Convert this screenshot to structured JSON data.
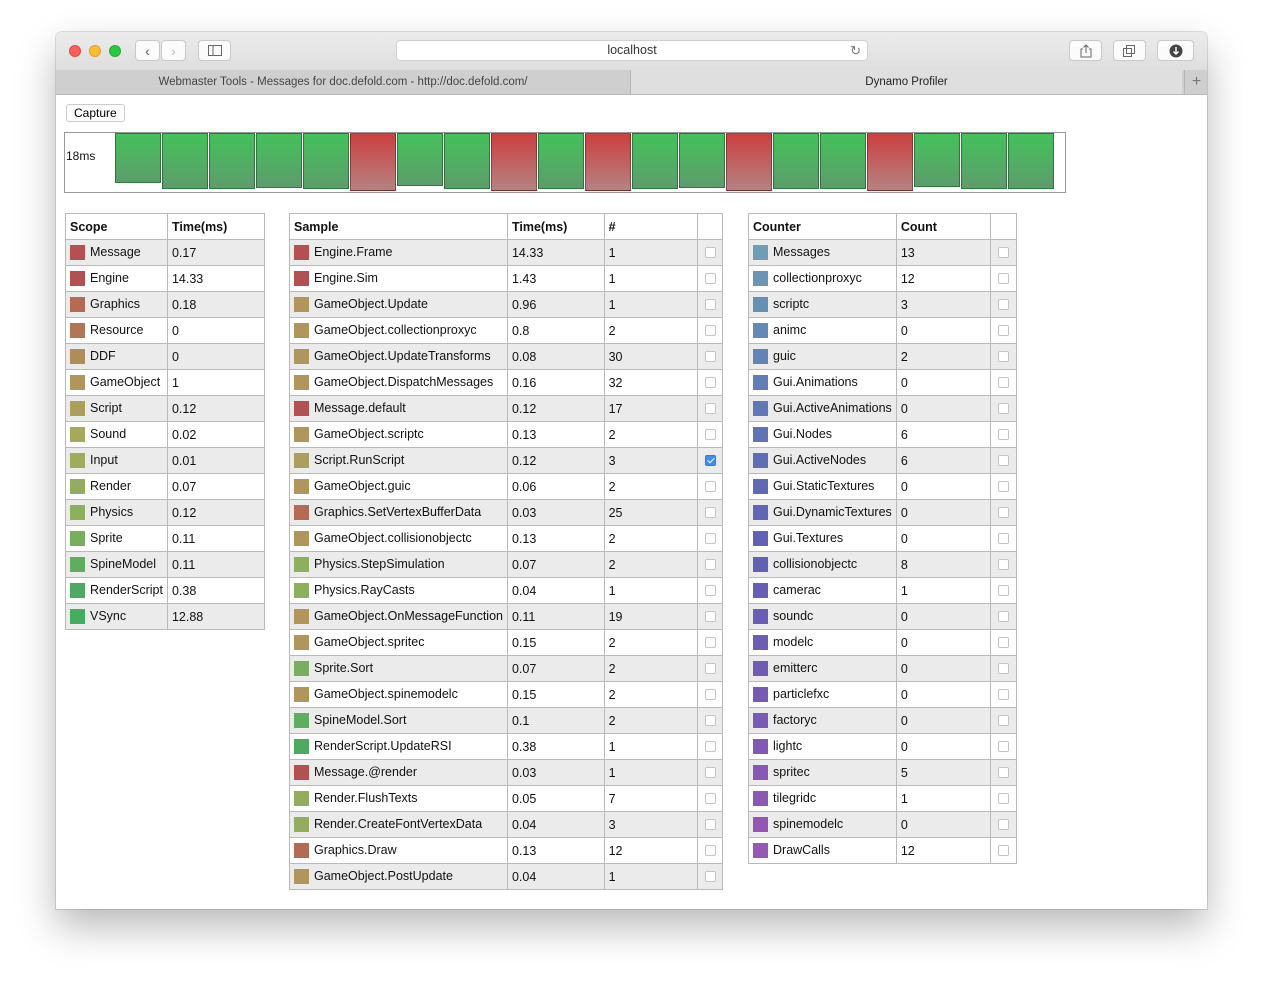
{
  "browser": {
    "address": "localhost",
    "tabs": [
      "Webmaster Tools - Messages for doc.defold.com - http://doc.defold.com/",
      "Dynamo Profiler"
    ],
    "plus": "+"
  },
  "profiler": {
    "capture_label": "Capture",
    "frame_label": "18ms",
    "frames": [
      {
        "status": "green",
        "fill": 0.89
      },
      {
        "status": "green",
        "fill": 1.0
      },
      {
        "status": "green",
        "fill": 1.0
      },
      {
        "status": "green",
        "fill": 0.98
      },
      {
        "status": "green",
        "fill": 1.0
      },
      {
        "status": "red",
        "fill": 1.04
      },
      {
        "status": "green",
        "fill": 0.95
      },
      {
        "status": "green",
        "fill": 1.0
      },
      {
        "status": "red",
        "fill": 1.04
      },
      {
        "status": "green",
        "fill": 1.0
      },
      {
        "status": "red",
        "fill": 1.04
      },
      {
        "status": "green",
        "fill": 1.0
      },
      {
        "status": "green",
        "fill": 0.98
      },
      {
        "status": "red",
        "fill": 1.04
      },
      {
        "status": "green",
        "fill": 1.0
      },
      {
        "status": "green",
        "fill": 1.0
      },
      {
        "status": "red",
        "fill": 1.04
      },
      {
        "status": "green",
        "fill": 0.97
      },
      {
        "status": "green",
        "fill": 1.0
      },
      {
        "status": "green",
        "fill": 1.0
      }
    ]
  },
  "scope_table": {
    "headers": [
      "Scope",
      "Time(ms)"
    ],
    "rows": [
      {
        "name": "Message",
        "time": "0.17",
        "color": "#b45052"
      },
      {
        "name": "Engine",
        "time": "14.33",
        "color": "#b45052"
      },
      {
        "name": "Graphics",
        "time": "0.18",
        "color": "#b36b53"
      },
      {
        "name": "Resource",
        "time": "0",
        "color": "#b07757"
      },
      {
        "name": "DDF",
        "time": "0",
        "color": "#b08c5b"
      },
      {
        "name": "GameObject",
        "time": "1",
        "color": "#b0965c"
      },
      {
        "name": "Script",
        "time": "0.12",
        "color": "#ac9f5c"
      },
      {
        "name": "Sound",
        "time": "0.02",
        "color": "#a6a85c"
      },
      {
        "name": "Input",
        "time": "0.01",
        "color": "#9fac5c"
      },
      {
        "name": "Render",
        "time": "0.07",
        "color": "#91ad5d"
      },
      {
        "name": "Physics",
        "time": "0.12",
        "color": "#8cb05e"
      },
      {
        "name": "Sprite",
        "time": "0.11",
        "color": "#7aae5f"
      },
      {
        "name": "SpineModel",
        "time": "0.11",
        "color": "#5fad60"
      },
      {
        "name": "RenderScript",
        "time": "0.38",
        "color": "#4daa60"
      },
      {
        "name": "VSync",
        "time": "12.88",
        "color": "#45ad5d"
      }
    ]
  },
  "sample_table": {
    "headers": [
      "Sample",
      "Time(ms)",
      "#",
      ""
    ],
    "rows": [
      {
        "name": "Engine.Frame",
        "time": "14.33",
        "count": "1",
        "checked": false,
        "color": "#b45052"
      },
      {
        "name": "Engine.Sim",
        "time": "1.43",
        "count": "1",
        "checked": false,
        "color": "#b45052"
      },
      {
        "name": "GameObject.Update",
        "time": "0.96",
        "count": "1",
        "checked": false,
        "color": "#b0965c"
      },
      {
        "name": "GameObject.collectionproxyc",
        "time": "0.8",
        "count": "2",
        "checked": false,
        "color": "#b0965c"
      },
      {
        "name": "GameObject.UpdateTransforms",
        "time": "0.08",
        "count": "30",
        "checked": false,
        "color": "#b0965c"
      },
      {
        "name": "GameObject.DispatchMessages",
        "time": "0.16",
        "count": "32",
        "checked": false,
        "color": "#b0965c"
      },
      {
        "name": "Message.default",
        "time": "0.12",
        "count": "17",
        "checked": false,
        "color": "#b45052"
      },
      {
        "name": "GameObject.scriptc",
        "time": "0.13",
        "count": "2",
        "checked": false,
        "color": "#b0965c"
      },
      {
        "name": "Script.RunScript",
        "time": "0.12",
        "count": "3",
        "checked": true,
        "color": "#ac9f5c"
      },
      {
        "name": "GameObject.guic",
        "time": "0.06",
        "count": "2",
        "checked": false,
        "color": "#b0965c"
      },
      {
        "name": "Graphics.SetVertexBufferData",
        "time": "0.03",
        "count": "25",
        "checked": false,
        "color": "#b36b53"
      },
      {
        "name": "GameObject.collisionobjectc",
        "time": "0.13",
        "count": "2",
        "checked": false,
        "color": "#b0965c"
      },
      {
        "name": "Physics.StepSimulation",
        "time": "0.07",
        "count": "2",
        "checked": false,
        "color": "#8cb05e"
      },
      {
        "name": "Physics.RayCasts",
        "time": "0.04",
        "count": "1",
        "checked": false,
        "color": "#8cb05e"
      },
      {
        "name": "GameObject.OnMessageFunction",
        "time": "0.11",
        "count": "19",
        "checked": false,
        "color": "#b0965c"
      },
      {
        "name": "GameObject.spritec",
        "time": "0.15",
        "count": "2",
        "checked": false,
        "color": "#b0965c"
      },
      {
        "name": "Sprite.Sort",
        "time": "0.07",
        "count": "2",
        "checked": false,
        "color": "#7aae5f"
      },
      {
        "name": "GameObject.spinemodelc",
        "time": "0.15",
        "count": "2",
        "checked": false,
        "color": "#b0965c"
      },
      {
        "name": "SpineModel.Sort",
        "time": "0.1",
        "count": "2",
        "checked": false,
        "color": "#5fad60"
      },
      {
        "name": "RenderScript.UpdateRSI",
        "time": "0.38",
        "count": "1",
        "checked": false,
        "color": "#4daa60"
      },
      {
        "name": "Message.@render",
        "time": "0.03",
        "count": "1",
        "checked": false,
        "color": "#b45052"
      },
      {
        "name": "Render.FlushTexts",
        "time": "0.05",
        "count": "7",
        "checked": false,
        "color": "#91ad5d"
      },
      {
        "name": "Render.CreateFontVertexData",
        "time": "0.04",
        "count": "3",
        "checked": false,
        "color": "#91ad5d"
      },
      {
        "name": "Graphics.Draw",
        "time": "0.13",
        "count": "12",
        "checked": false,
        "color": "#b36b53"
      },
      {
        "name": "GameObject.PostUpdate",
        "time": "0.04",
        "count": "1",
        "checked": false,
        "color": "#b0965c"
      }
    ]
  },
  "counter_table": {
    "headers": [
      "Counter",
      "Count",
      ""
    ],
    "rows": [
      {
        "name": "Messages",
        "count": "13",
        "checked": false,
        "color": "#6f9db5"
      },
      {
        "name": "collectionproxyc",
        "count": "12",
        "checked": false,
        "color": "#6996b5"
      },
      {
        "name": "scriptc",
        "count": "3",
        "checked": false,
        "color": "#6590b6"
      },
      {
        "name": "animc",
        "count": "0",
        "checked": false,
        "color": "#6389b6"
      },
      {
        "name": "guic",
        "count": "2",
        "checked": false,
        "color": "#6283b6"
      },
      {
        "name": "Gui.Animations",
        "count": "0",
        "checked": false,
        "color": "#617eb6"
      },
      {
        "name": "Gui.ActiveAnimations",
        "count": "0",
        "checked": false,
        "color": "#6078b6"
      },
      {
        "name": "Gui.Nodes",
        "count": "6",
        "checked": false,
        "color": "#5f73b6"
      },
      {
        "name": "Gui.ActiveNodes",
        "count": "6",
        "checked": false,
        "color": "#5f6fb6"
      },
      {
        "name": "Gui.StaticTextures",
        "count": "0",
        "checked": false,
        "color": "#5f6ab6"
      },
      {
        "name": "Gui.DynamicTextures",
        "count": "0",
        "checked": false,
        "color": "#5f66b6"
      },
      {
        "name": "Gui.Textures",
        "count": "0",
        "checked": false,
        "color": "#6063b5"
      },
      {
        "name": "collisionobjectc",
        "count": "8",
        "checked": false,
        "color": "#6260b5"
      },
      {
        "name": "camerac",
        "count": "1",
        "checked": false,
        "color": "#655fb5"
      },
      {
        "name": "soundc",
        "count": "0",
        "checked": false,
        "color": "#695eb5"
      },
      {
        "name": "modelc",
        "count": "0",
        "checked": false,
        "color": "#6d5db5"
      },
      {
        "name": "emitterc",
        "count": "0",
        "checked": false,
        "color": "#715cb5"
      },
      {
        "name": "particlefxc",
        "count": "0",
        "checked": false,
        "color": "#765bb5"
      },
      {
        "name": "factoryc",
        "count": "0",
        "checked": false,
        "color": "#7b5ab5"
      },
      {
        "name": "lightc",
        "count": "0",
        "checked": false,
        "color": "#8159b5"
      },
      {
        "name": "spritec",
        "count": "5",
        "checked": false,
        "color": "#8758b5"
      },
      {
        "name": "tilegridc",
        "count": "1",
        "checked": false,
        "color": "#8d57b5"
      },
      {
        "name": "spinemodelc",
        "count": "0",
        "checked": false,
        "color": "#9356b5"
      },
      {
        "name": "DrawCalls",
        "count": "12",
        "checked": false,
        "color": "#9856b5"
      }
    ]
  }
}
